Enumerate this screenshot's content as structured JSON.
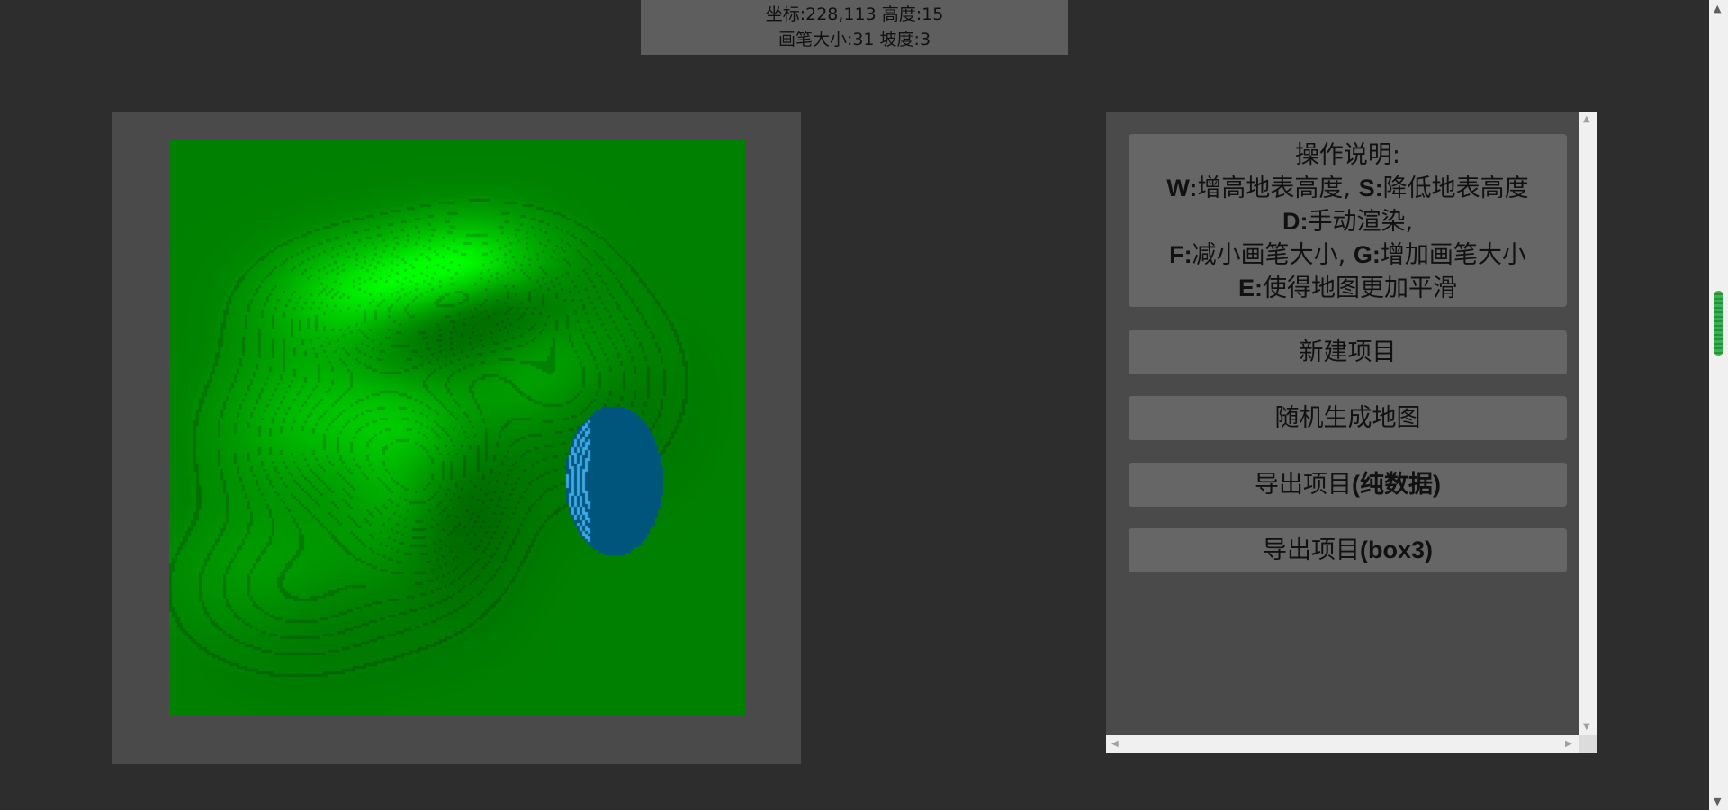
{
  "status": {
    "line1": "坐标:228,113 高度:15",
    "line2": "画笔大小:31 坡度:3"
  },
  "colors": {
    "background": "#2d2d2d",
    "grass": "#008000",
    "water": "#004f7a",
    "panel": "#4a4a4a",
    "button": "#666666"
  },
  "help": {
    "title": "操作说明:",
    "w_key": "W:",
    "w_desc": "增高地表高度,",
    "s_key": "S:",
    "s_desc": "降低地表高度",
    "d_key": "D:",
    "d_desc": "手动渲染,",
    "f_key": "F:",
    "f_desc": "减小画笔大小,",
    "g_key": "G:",
    "g_desc": "增加画笔大小",
    "e_key": "E:",
    "e_desc": "使得地图更加平滑"
  },
  "buttons": {
    "new_project": "新建项目",
    "random_map": "随机生成地图",
    "export_data_prefix": "导出项目",
    "export_data_suffix": "(纯数据)",
    "export_box3_prefix": "导出项目",
    "export_box3_suffix": "(box3)"
  },
  "icons": {
    "scroll_up": "triangle-up",
    "scroll_down": "triangle-down",
    "scroll_left": "triangle-left",
    "scroll_right": "triangle-right"
  }
}
